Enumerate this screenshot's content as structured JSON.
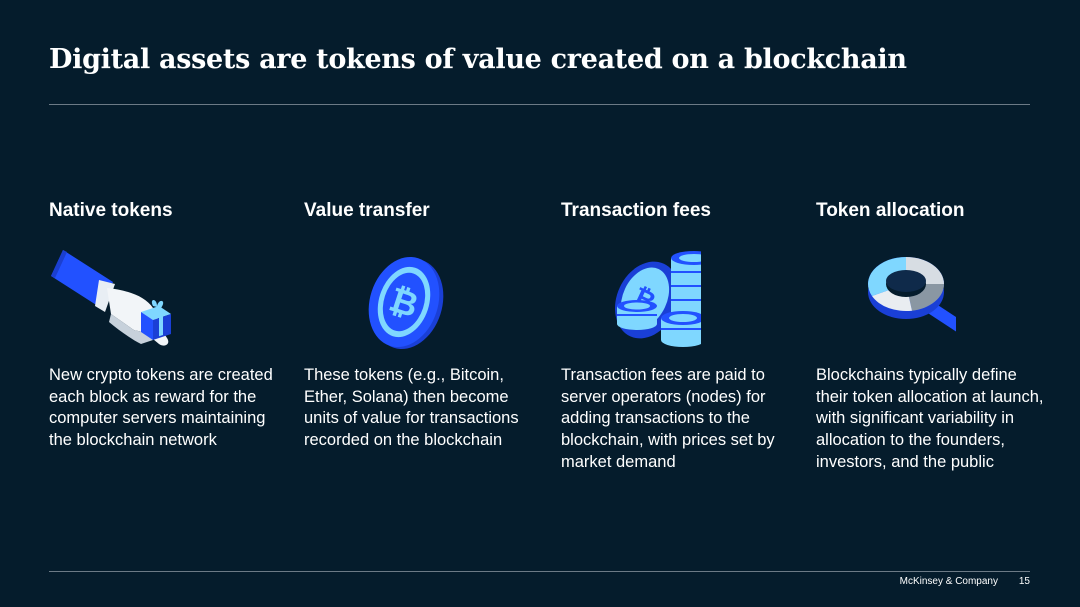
{
  "slide": {
    "title": "Digital assets are tokens of value created on a blockchain"
  },
  "columns": [
    {
      "heading": "Native tokens",
      "icon": "hand-giving-gift-icon",
      "body": "New crypto tokens are created each block as reward for the computer servers maintaining the blockchain network"
    },
    {
      "heading": "Value transfer",
      "icon": "bitcoin-coin-icon",
      "body": "These tokens (e.g., Bitcoin, Ether, Solana) then become units of value for transactions recorded on the blockchain"
    },
    {
      "heading": "Transaction fees",
      "icon": "coin-stacks-icon",
      "body": "Transaction fees are paid to server operators (nodes) for adding transactions to the blockchain, with prices set by market demand"
    },
    {
      "heading": "Token allocation",
      "icon": "magnifier-pie-chart-icon",
      "body": "Blockchains typically define their token allocation at launch, with significant variability in allocation to the founders, investors, and the public"
    }
  ],
  "footer": {
    "brand": "McKinsey & Company",
    "page_number": "15"
  },
  "colors": {
    "background": "#051c2c",
    "accent_blue": "#2251ff",
    "light_blue": "#7fd7ff",
    "rule": "#6c7a86"
  }
}
